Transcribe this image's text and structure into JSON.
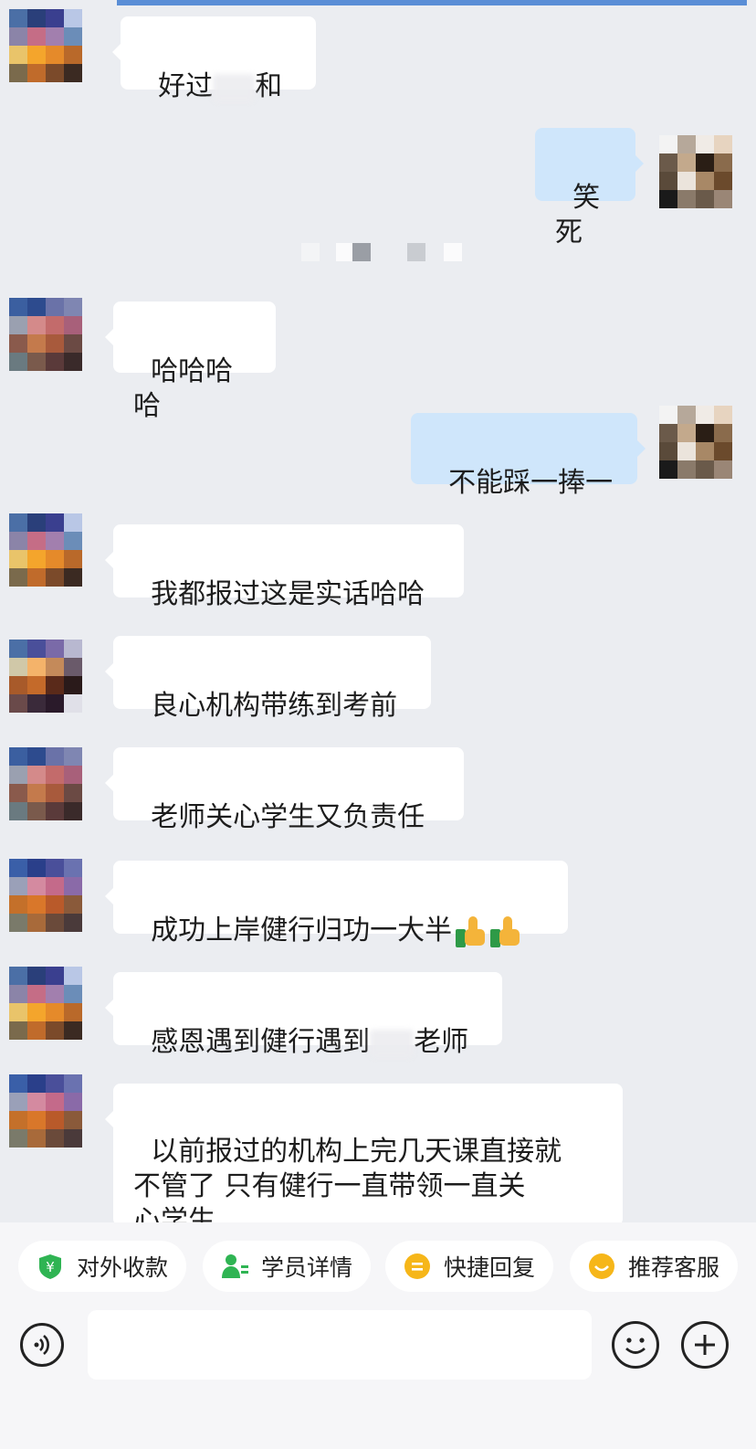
{
  "colors": {
    "background": "#ebedf1",
    "incoming_bubble": "#ffffff",
    "outgoing_bubble": "#cfe6fb",
    "accent_green": "#2fb453",
    "accent_yellow": "#f6b619"
  },
  "messages": [
    {
      "direction": "incoming",
      "text_before": "好过",
      "text_after": "和",
      "has_redaction": true
    },
    {
      "direction": "outgoing",
      "text": "笑死"
    },
    {
      "direction": "incoming",
      "text": "哈哈哈哈"
    },
    {
      "direction": "outgoing",
      "text": "不能踩一捧一"
    },
    {
      "direction": "incoming",
      "text": "我都报过这是实话哈哈"
    },
    {
      "direction": "incoming",
      "text": "良心机构带练到考前"
    },
    {
      "direction": "incoming",
      "text": "老师关心学生又负责任"
    },
    {
      "direction": "incoming",
      "text": "成功上岸健行归功一大半",
      "emoji": [
        "thumbs-up",
        "thumbs-up"
      ]
    },
    {
      "direction": "incoming",
      "text_before": "感恩遇到健行遇到",
      "text_after": "老师",
      "has_redaction": true
    },
    {
      "direction": "incoming",
      "text": "以前报过的机构上完几天课直接就\n不管了 只有健行一直带领一直关\n心学生"
    }
  ],
  "quick_actions": [
    {
      "label": "对外收款",
      "icon": "yuan-shield-icon"
    },
    {
      "label": "学员详情",
      "icon": "student-icon"
    },
    {
      "label": "快捷回复",
      "icon": "quick-reply-icon"
    },
    {
      "label": "推荐客服",
      "icon": "service-icon"
    }
  ],
  "input": {
    "value": "",
    "voice_icon": "voice-icon",
    "emoji_icon": "emoji-icon",
    "add_icon": "add-icon"
  }
}
